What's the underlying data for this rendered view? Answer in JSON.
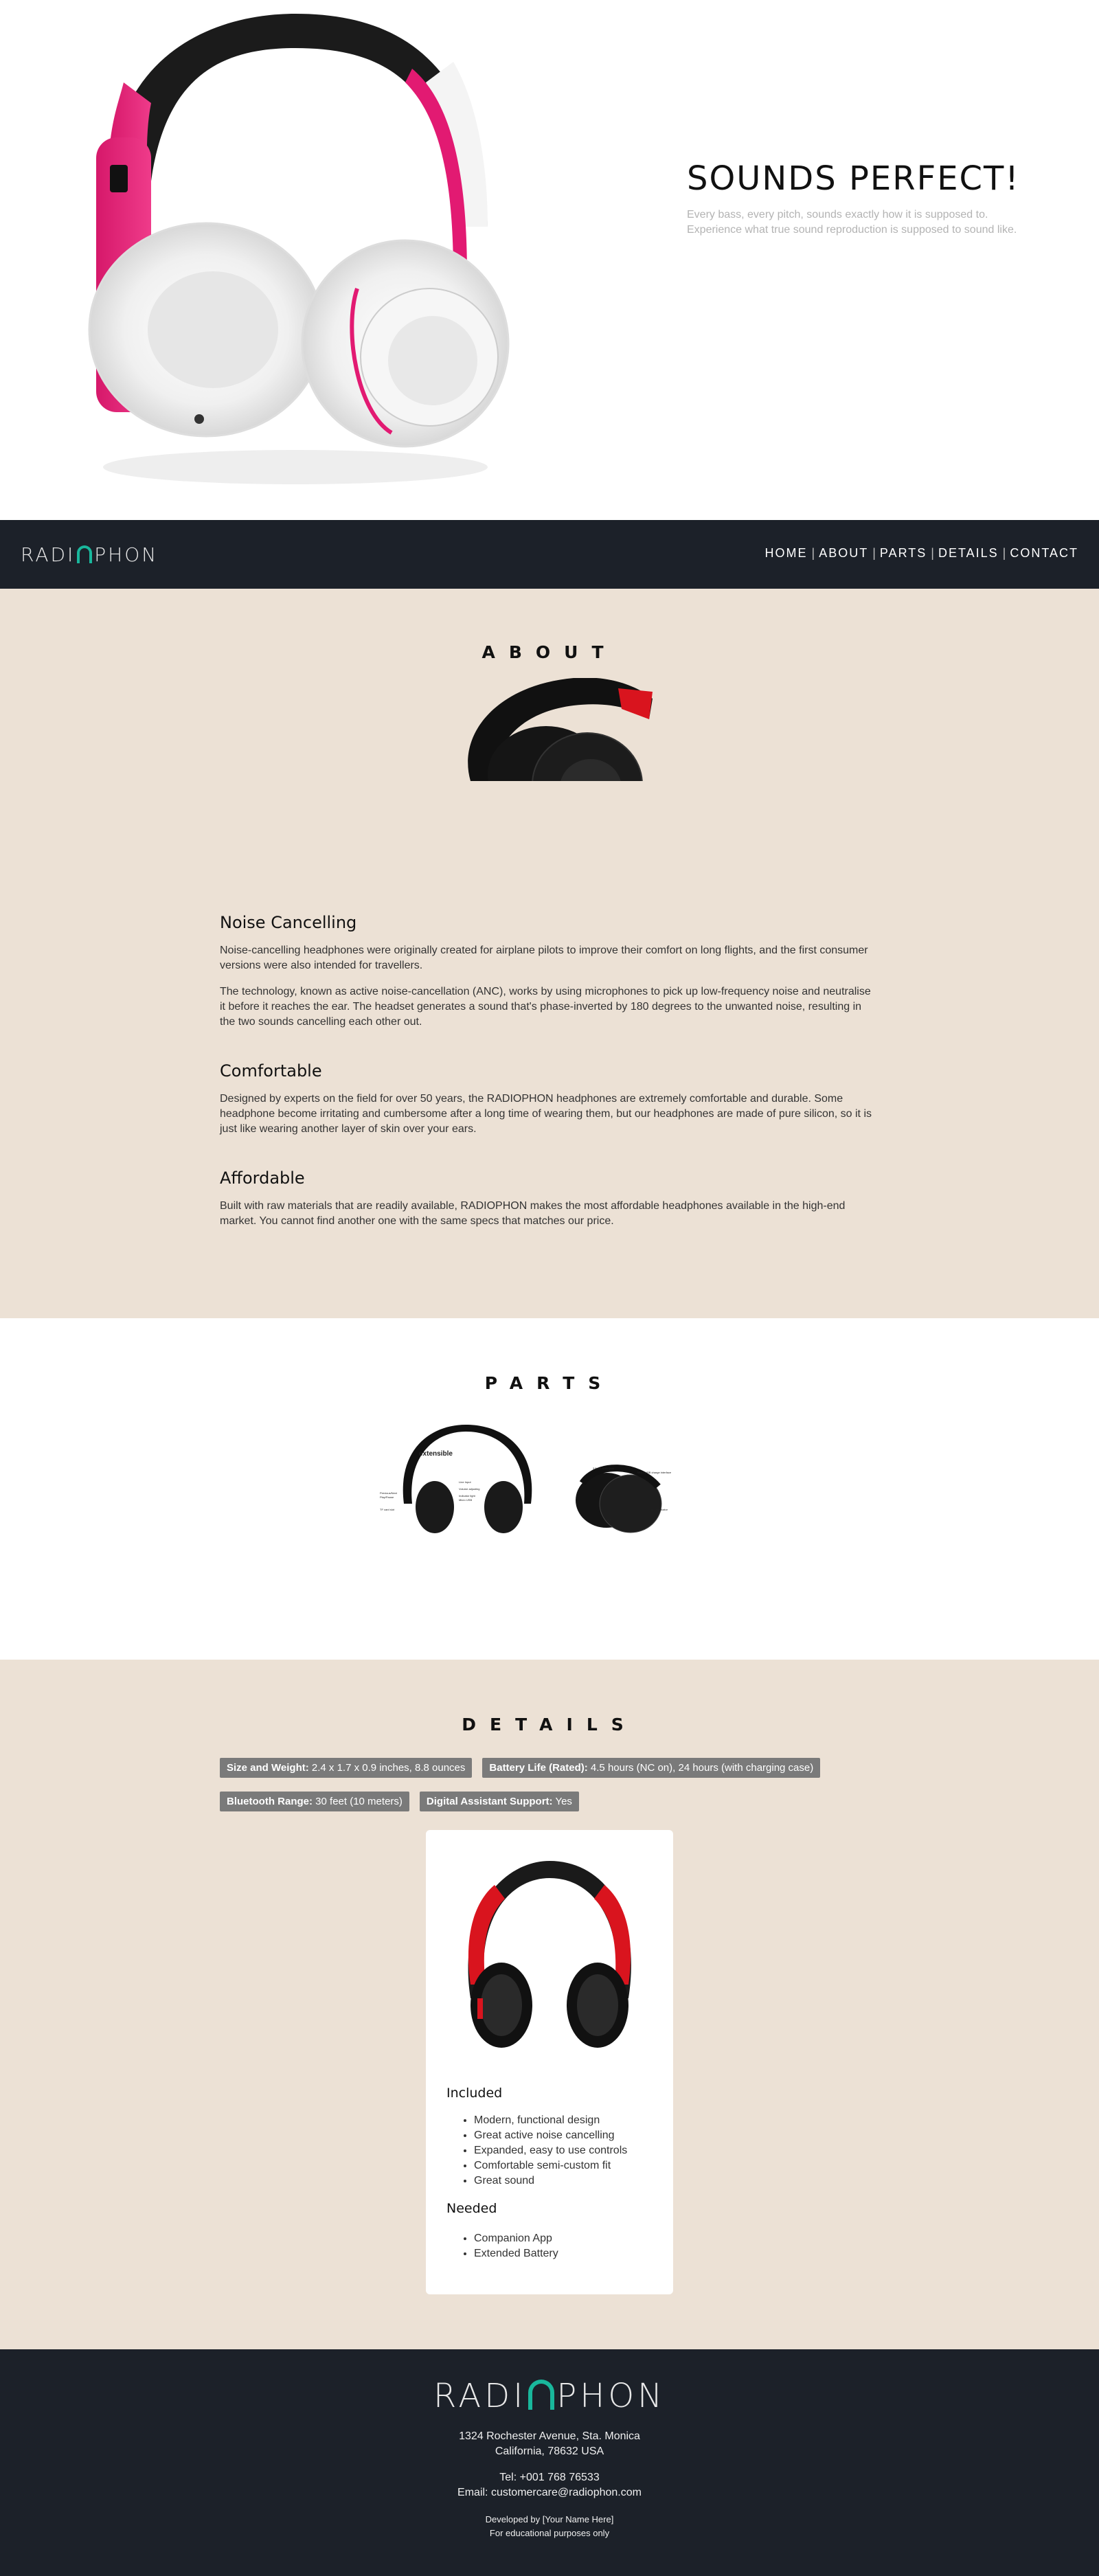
{
  "hero": {
    "title": "SOUNDS PERFECT!",
    "subtitle": "Every bass, every pitch, sounds exactly how it is supposed to. Experience what true sound reproduction is supposed to sound like."
  },
  "nav": {
    "logo_left": "RADI",
    "logo_right": "PHON",
    "links": [
      "HOME",
      "ABOUT",
      "PARTS",
      "DETAILS",
      "CONTACT"
    ]
  },
  "about": {
    "title": "ABOUT",
    "blocks": [
      {
        "heading": "Noise Cancelling",
        "paragraphs": [
          "Noise-cancelling headphones were originally created for airplane pilots to improve their comfort on long flights, and the first consumer versions were also intended for travellers.",
          "The technology, known as active noise-cancellation (ANC), works by using microphones to pick up low-frequency noise and neutralise it before it reaches the ear. The headset generates a sound that's phase-inverted by 180 degrees to the unwanted noise, resulting in the two sounds cancelling each other out."
        ]
      },
      {
        "heading": "Comfortable",
        "paragraphs": [
          "Designed by experts on the field for over 50 years, the RADIOPHON headphones are extremely comfortable and durable. Some headphone become irritating and cumbersome after a long time of wearing them, but our headphones are made of pure silicon, so it is just like wearing another layer of skin over your ears."
        ]
      },
      {
        "heading": "Affordable",
        "paragraphs": [
          "Built with raw materials that are readily available, RADIOPHON makes the most affordable headphones available in the high-end market. You cannot find another one with the same specs that matches our price."
        ]
      }
    ]
  },
  "parts": {
    "title": "PARTS",
    "labels": [
      "extensible",
      "Line Input",
      "Volume adjusting",
      "Previous/Next",
      "Play/Pause",
      "TF card slot",
      "Indicator light",
      "Micro USB",
      "3.5mm audio jack",
      "Micro-USB charge interface",
      "LED indicator",
      "Mic"
    ]
  },
  "details": {
    "title": "DETAILS",
    "specs": [
      {
        "key": "Size and Weight:",
        "value": "2.4 x 1.7 x 0.9 inches, 8.8 ounces"
      },
      {
        "key": "Battery Life (Rated):",
        "value": "4.5 hours (NC on), 24 hours (with charging case)"
      },
      {
        "key": "Bluetooth Range:",
        "value": "30 feet (10 meters)"
      },
      {
        "key": "Digital Assistant Support:",
        "value": "Yes"
      }
    ],
    "included_heading": "Included",
    "included": [
      "Modern, functional design",
      "Great active noise cancelling",
      "Expanded, easy to use controls",
      "Comfortable semi-custom fit",
      "Great sound"
    ],
    "needed_heading": "Needed",
    "needed": [
      "Companion App",
      "Extended Battery"
    ]
  },
  "footer": {
    "address1": "1324 Rochester Avenue, Sta. Monica",
    "address2": "California, 78632 USA",
    "tel": "Tel: +001 768 76533",
    "email": "Email: customercare@radiophon.com",
    "dev": "Developed by [Your Name Here]",
    "edu": "For educational purposes only"
  },
  "colors": {
    "nav_bg": "#1c2129",
    "beige": "#ece1d5",
    "accent_teal": "#19b79c",
    "spec_badge": "#7a7a7a"
  }
}
